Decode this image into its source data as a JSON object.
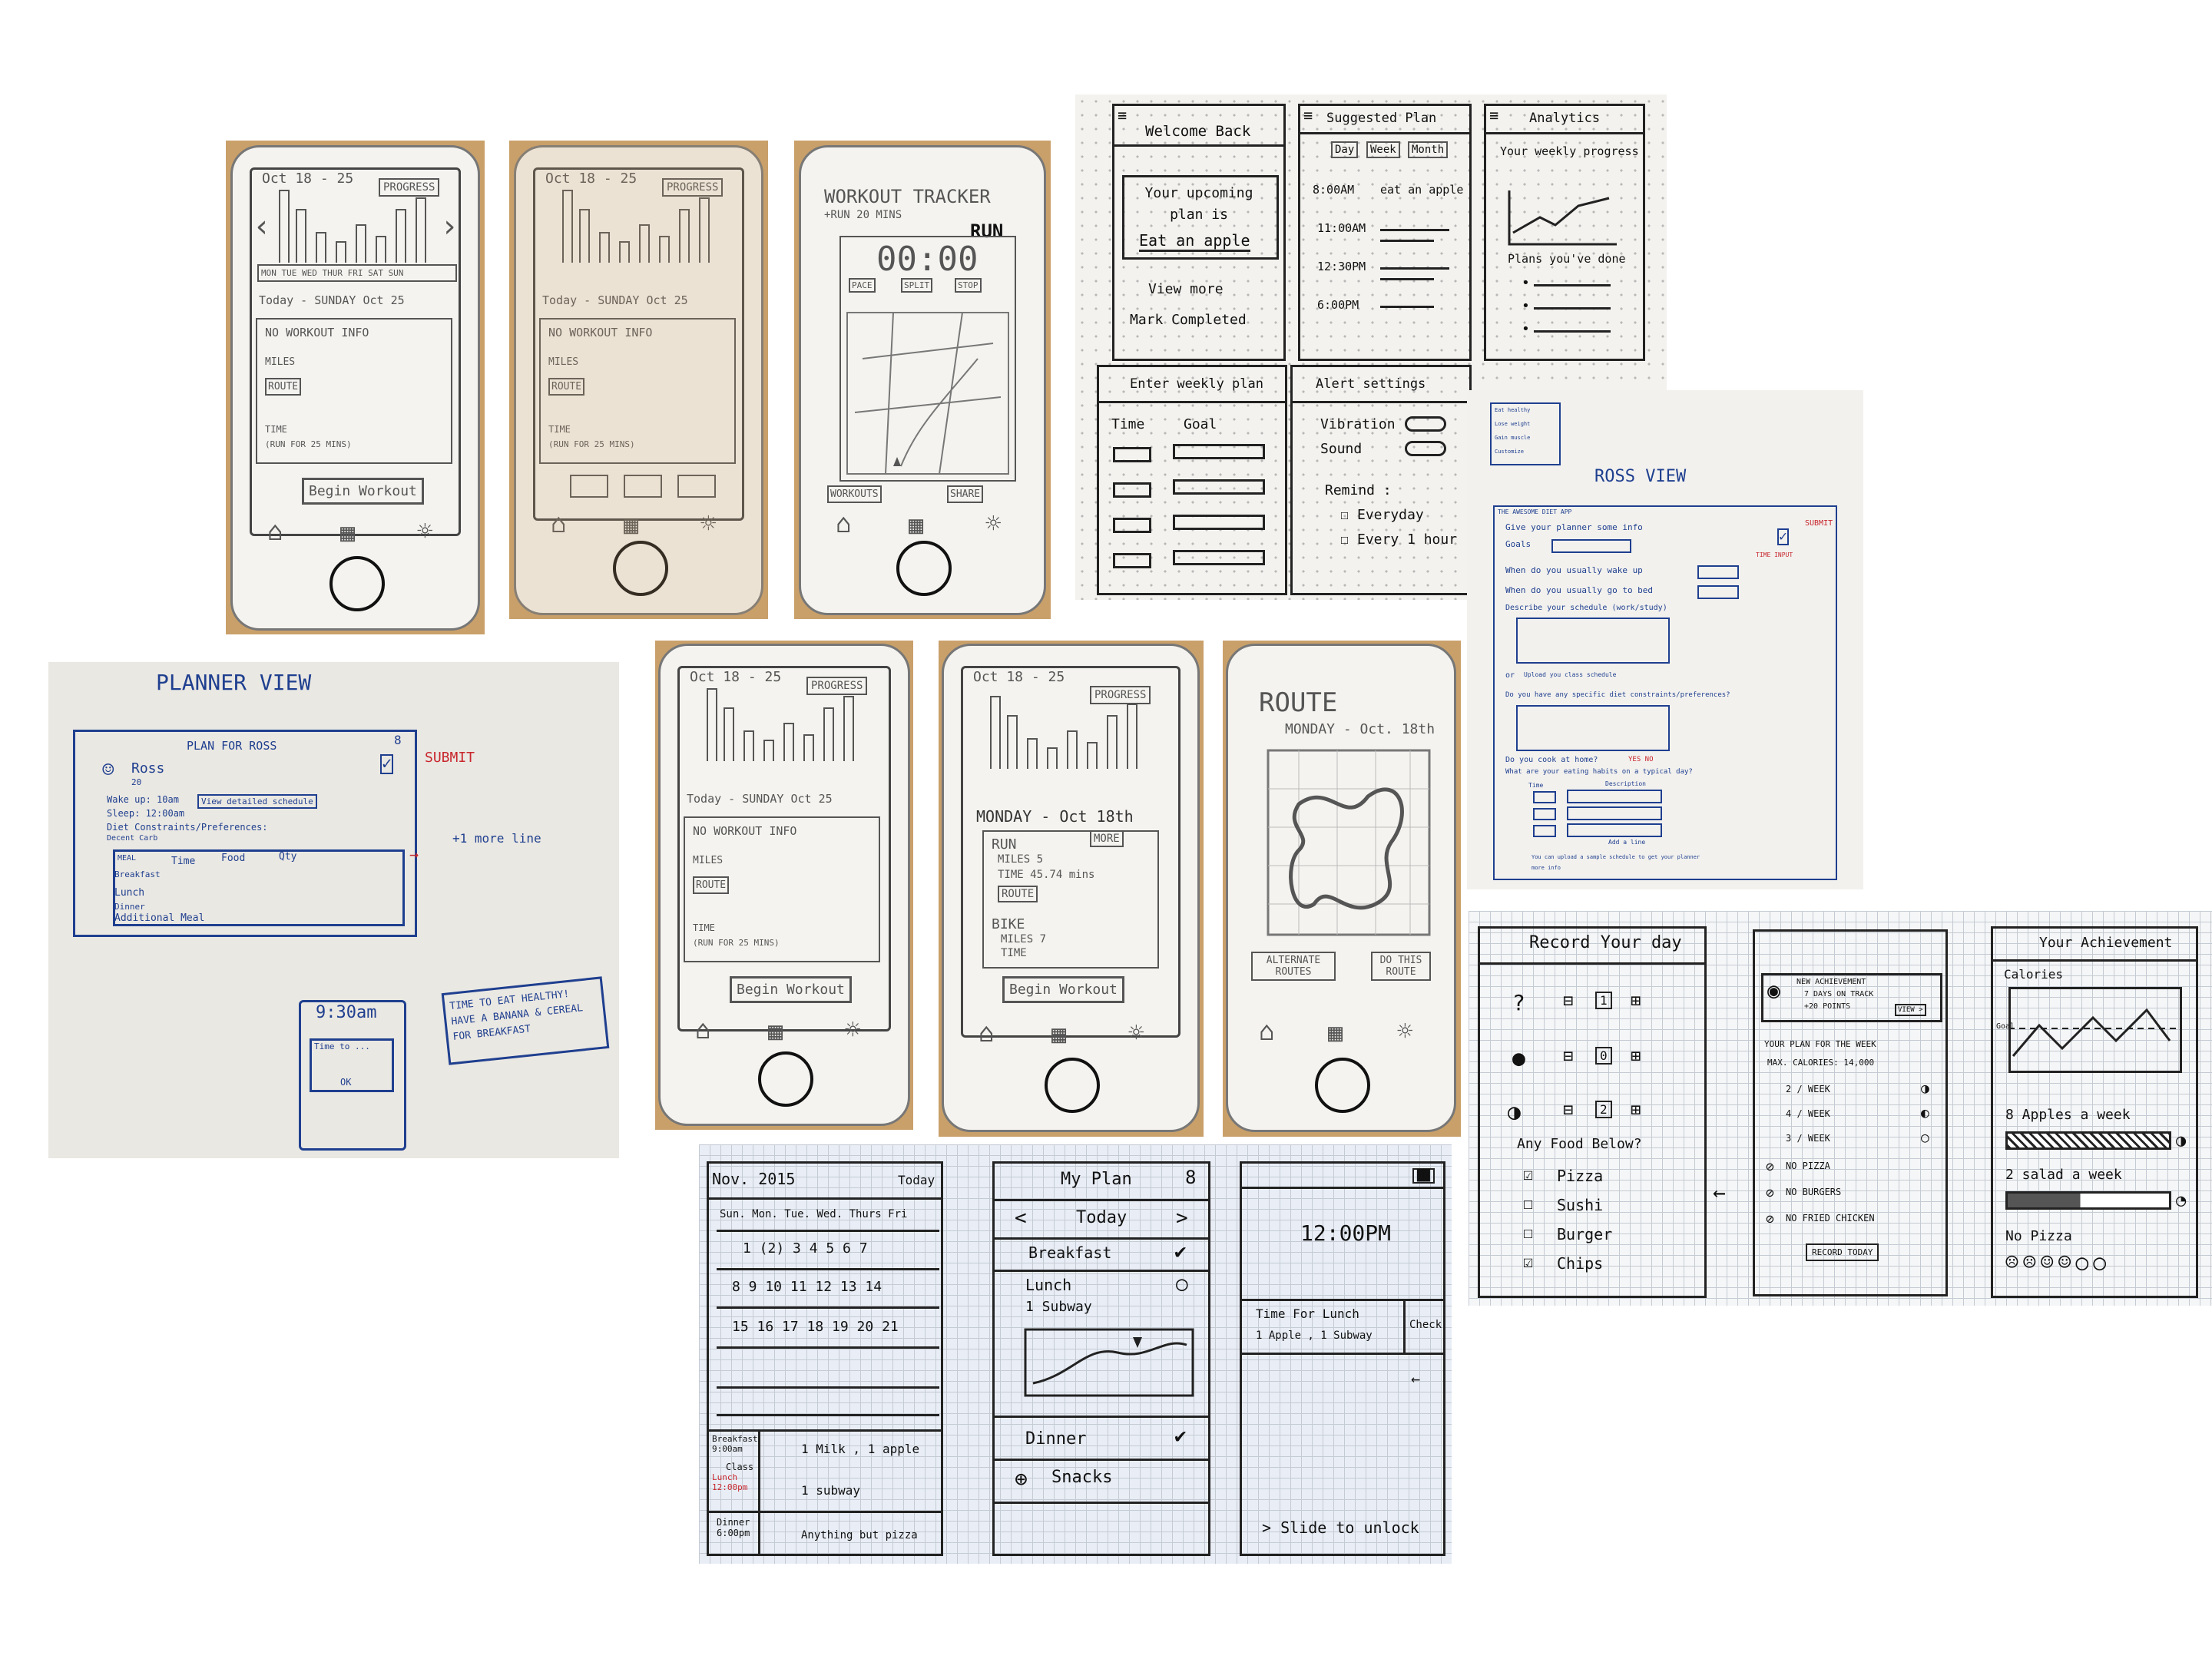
{
  "phone1": {
    "date": "Oct 18 - 25",
    "progress": "PROGRESS",
    "days": "MON TUE WED THUR FRI SAT SUN",
    "today": "Today - SUNDAY Oct 25",
    "no_workout": "NO WORKOUT INFO",
    "miles": "MILES",
    "route": "ROUTE",
    "time": "TIME",
    "run_note": "(RUN FOR 25 MINS)",
    "begin": "Begin Workout"
  },
  "phone2": {
    "date": "Oct 18 - 25",
    "progress": "PROGRESS",
    "today": "Today - SUNDAY Oct 25",
    "no_workout": "NO WORKOUT INFO",
    "miles": "MILES",
    "route": "ROUTE",
    "time": "TIME",
    "run_note": "(RUN FOR 25 MINS)"
  },
  "phone3": {
    "title": "WORKOUT TRACKER",
    "sub": "+RUN 20 MINS",
    "run": "RUN",
    "timer": "00:00",
    "pace": "PACE",
    "split": "SPLIT",
    "stop": "STOP",
    "workouts": "WORKOUTS",
    "share": "SHARE"
  },
  "phone4": {
    "date": "Oct 18 - 25",
    "progress": "PROGRESS",
    "today": "Today - SUNDAY Oct 25",
    "no_workout": "NO WORKOUT INFO",
    "miles": "MILES",
    "route": "ROUTE",
    "time": "TIME",
    "run_note": "(RUN FOR 25 MINS)",
    "begin": "Begin Workout"
  },
  "phone5": {
    "date": "Oct 18 - 25",
    "progress": "PROGRESS",
    "day": "MONDAY - Oct 18th",
    "run": "RUN",
    "more": "MORE",
    "miles": "MILES 5",
    "time": "TIME 45.74 mins",
    "route": "ROUTE",
    "bike": "BIKE",
    "bike_miles": "MILES 7",
    "bike_time": "TIME",
    "begin": "Begin Workout"
  },
  "phone6": {
    "title": "ROUTE",
    "date": "MONDAY - Oct. 18th",
    "alt": "ALTERNATE ROUTES",
    "do": "DO THIS ROUTE"
  },
  "wire": {
    "welcome": "Welcome Back",
    "upcoming": "Your upcoming plan is",
    "eat": "Eat an apple",
    "view_more": "View more",
    "mark": "Mark Completed",
    "suggested": "Suggested Plan",
    "day": "Day",
    "week": "Week",
    "month": "Month",
    "t1": "8:00AM",
    "t1_text": "eat an apple",
    "t2": "11:00AM",
    "t3": "12:30PM",
    "t4": "6:00PM",
    "analytics": "Analytics",
    "weekly": "Your weekly progress",
    "plans_done": "Plans you've done",
    "enter": "Enter weekly plan",
    "time": "Time",
    "goal": "Goal",
    "alert": "Alert settings",
    "vibration": "Vibration",
    "sound": "Sound",
    "remind": "Remind :",
    "everyday": "Everyday",
    "every_hour": "Every 1 hour"
  },
  "planner": {
    "title": "PLANNER VIEW",
    "plan_for": "PLAN FOR ROSS",
    "name": "Ross",
    "age": "20",
    "wake": "Wake up: 10am",
    "sleep": "Sleep: 12:00am",
    "view": "View detailed schedule",
    "diet": "Diet Constraints/Preferences:",
    "diet2": "Decent Carb",
    "meal": "MEAL",
    "time": "Time",
    "food": "Food",
    "qty": "Qty",
    "breakfast": "Breakfast",
    "lunch": "Lunch",
    "dinner": "Dinner",
    "additional": "Additional Meal",
    "submit": "SUBMIT",
    "more_line": "+1 more line",
    "clock": "9:30am",
    "time_to": "Time to ...",
    "ok": "OK",
    "note": "TIME TO EAT HEALTHY! HAVE A BANANA & CEREAL FOR BREAKFAST"
  },
  "ross": {
    "title": "ROSS VIEW",
    "header": "THE AWESOME DIET APP",
    "give": "Give your planner some info",
    "goals": "Goals",
    "wake": "When do you usually wake up",
    "bed": "When do you usually go to bed",
    "describe": "Describe your schedule (work/study)",
    "or": "or",
    "upload": "Upload you class schedule",
    "constraints": "Do you have any specific diet constraints/preferences?",
    "cook": "Do you cook at home?",
    "yes_no": "YES NO",
    "habits": "What are your eating habits on a typical day?",
    "time": "Time",
    "description": "Description",
    "add": "Add a line",
    "footer": "You can upload a sample schedule to get your planner",
    "footer2": "more info",
    "submit": "SUBMIT",
    "time_input": "TIME INPUT",
    "items": [
      "Eat healthy",
      "Lose weight",
      "Gain muscle",
      "Customize"
    ]
  },
  "record": {
    "title": "Record Your day",
    "any_food": "Any Food Below?",
    "foods": [
      "Pizza",
      "Sushi",
      "Burger",
      "Chips"
    ]
  },
  "achieve_mid": {
    "new": "NEW ACHIEVEMENT",
    "days": "7 DAYS ON TRACK",
    "points": "+20 POINTS",
    "view": "VIEW >",
    "plan": "YOUR PLAN FOR THE WEEK",
    "max_cal": "MAX. CALORIES: 14,000",
    "w2": "2 / WEEK",
    "w4": "4 / WEEK",
    "w3": "3 / WEEK",
    "no_pizza": "NO PIZZA",
    "no_burgers": "NO BURGERS",
    "no_fried": "NO FRIED CHICKEN",
    "record": "RECORD TODAY"
  },
  "achieve": {
    "title": "Your Achievement",
    "calories": "Calories",
    "goal": "Goal",
    "apples": "8 Apples a week",
    "salad": "2 salad a week",
    "no_pizza": "No Pizza"
  },
  "calendar": {
    "month": "Nov. 2015",
    "today": "Today",
    "days": "Sun. Mon. Tue. Wed. Thurs Fri",
    "row1": "1  (2)  3  4  5  6  7",
    "row2": "8  9  10  11  12  13  14",
    "row3": "15  16  17  18  19  20  21",
    "breakfast": "Breakfast 9:00am",
    "b_food": "1 Milk , 1 apple",
    "class": "Class",
    "lunch": "Lunch 12:00pm",
    "l_food": "1 subway",
    "dinner": "Dinner 6:00pm",
    "d_food": "Anything but pizza"
  },
  "myplan": {
    "title": "My Plan",
    "today": "Today",
    "breakfast": "Breakfast",
    "lunch": "Lunch",
    "lunch_item": "1 Subway",
    "dinner": "Dinner",
    "snacks": "Snacks"
  },
  "lock": {
    "time": "12:00PM",
    "notif": "Time For Lunch",
    "items": "1 Apple , 1 Subway",
    "check": "Check",
    "slide": "> Slide to unlock"
  }
}
